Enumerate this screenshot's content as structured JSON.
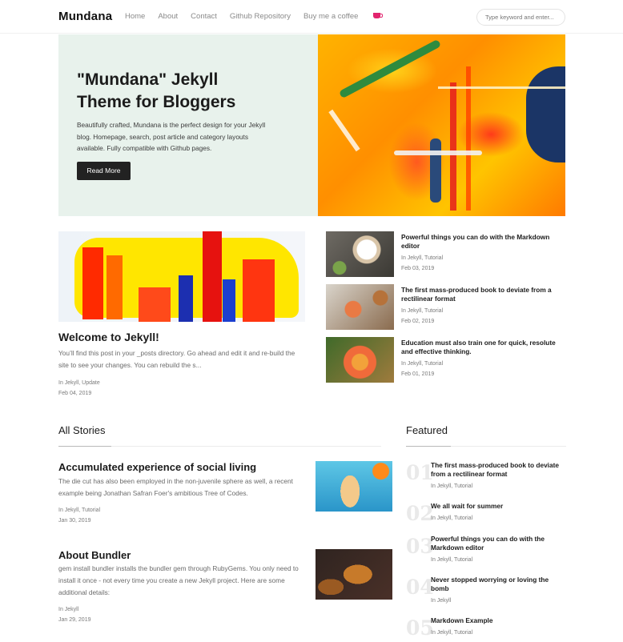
{
  "nav": {
    "brand": "Mundana",
    "links": [
      "Home",
      "About",
      "Contact",
      "Github Repository",
      "Buy me a coffee"
    ],
    "search_placeholder": "Type keyword and enter..."
  },
  "hero": {
    "title": "\"Mundana\" Jekyll Theme for Bloggers",
    "text": "Beautifully crafted, Mundana is the perfect design for your Jekyll blog. Homepage, search, post article and category layouts available. Fully compatible with Github pages.",
    "button": "Read More"
  },
  "featured_main": {
    "title": "Welcome to Jekyll!",
    "excerpt": "You’ll find this post in your _posts directory. Go ahead and edit it and re-build the site to see your changes. You can rebuild the s...",
    "categories": "In Jekyll, Update",
    "date": "Feb 04, 2019"
  },
  "side_posts": [
    {
      "title": "Powerful things you can do with the Markdown editor",
      "categories": "In Jekyll, Tutorial",
      "date": "Feb 03, 2019"
    },
    {
      "title": "The first mass-produced book to deviate from a rectilinear format",
      "categories": "In Jekyll, Tutorial",
      "date": "Feb 02, 2019"
    },
    {
      "title": "Education must also train one for quick, resolute and effective thinking.",
      "categories": "In Jekyll, Tutorial",
      "date": "Feb 01, 2019"
    }
  ],
  "all_stories": {
    "heading": "All Stories",
    "items": [
      {
        "title": "Accumulated experience of social living",
        "excerpt": "The die cut has also been employed in the non-juvenile sphere as well, a recent example being Jonathan Safran Foer's ambitious Tree of Codes.",
        "categories": "In Jekyll, Tutorial",
        "date": "Jan 30, 2019"
      },
      {
        "title": "About Bundler",
        "excerpt": "gem install bundler installs the bundler gem through RubyGems. You only need to install it once - not every time you create a new Jekyll project. Here are some additional details:",
        "categories": "In Jekyll",
        "date": "Jan 29, 2019"
      }
    ]
  },
  "featured": {
    "heading": "Featured",
    "items": [
      {
        "num": "01",
        "title": "The first mass-produced book to deviate from a rectilinear format",
        "categories": "In Jekyll, Tutorial"
      },
      {
        "num": "02",
        "title": "We all wait for summer",
        "categories": "In Jekyll, Tutorial"
      },
      {
        "num": "03",
        "title": "Powerful things you can do with the Markdown editor",
        "categories": "In Jekyll, Tutorial"
      },
      {
        "num": "04",
        "title": "Never stopped worrying or loving the bomb",
        "categories": "In Jekyll"
      },
      {
        "num": "05",
        "title": "Markdown Example",
        "categories": "In Jekyll, Tutorial"
      }
    ]
  },
  "colors": {
    "hero_bg": "#e8f2ec",
    "button_bg": "#222222",
    "coffee_accent": "#e2246e"
  }
}
